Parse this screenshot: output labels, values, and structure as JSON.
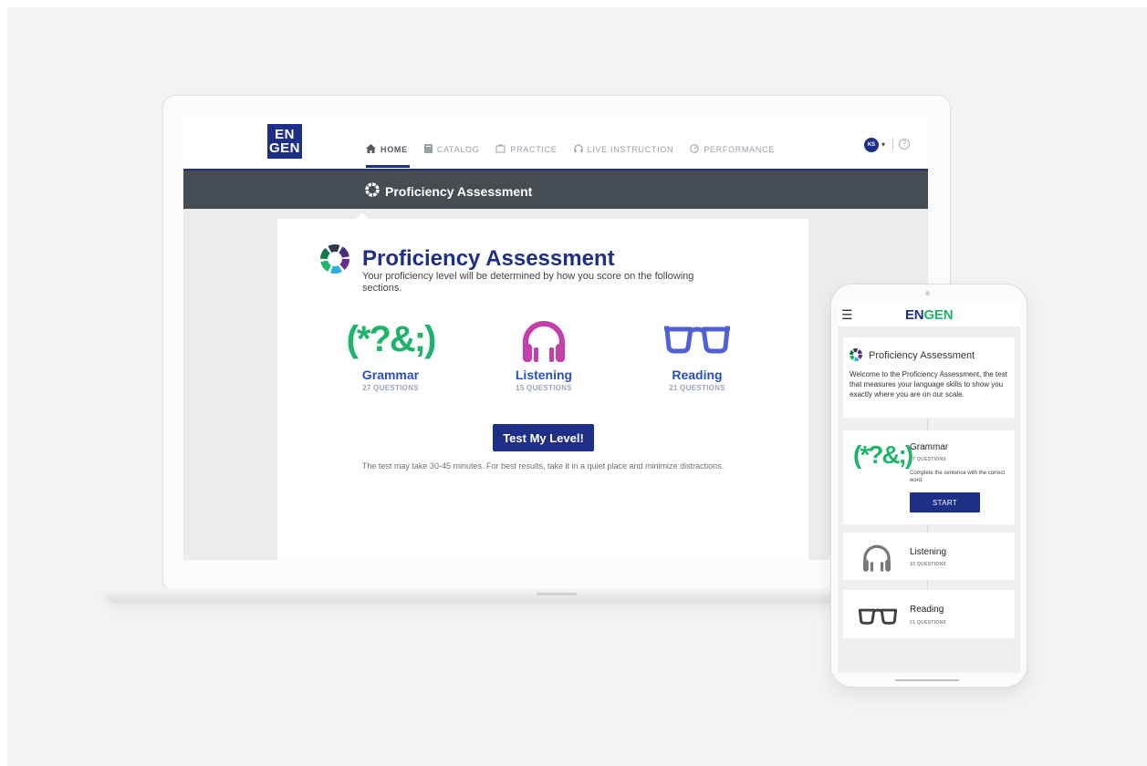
{
  "laptop": {
    "logo": {
      "line1": "EN",
      "line2": "GEN"
    },
    "nav": [
      {
        "label": "HOME",
        "icon": "home-icon",
        "active": true
      },
      {
        "label": "CATALOG",
        "icon": "book-icon",
        "active": false
      },
      {
        "label": "PRACTICE",
        "icon": "clipboard-icon",
        "active": false
      },
      {
        "label": "LIVE INSTRUCTION",
        "icon": "headset-icon",
        "active": false
      },
      {
        "label": "PERFORMANCE",
        "icon": "gauge-icon",
        "active": false
      }
    ],
    "user": {
      "initials": "KS",
      "help": "?"
    },
    "banner_title": "Proficiency Assessment",
    "card": {
      "title": "Proficiency Assessment",
      "subtitle": "Your proficiency level will be determined by how you score on the following sections.",
      "sections": [
        {
          "name": "Grammar",
          "count": "27 QUESTIONS",
          "glyph": "(*?&;)",
          "color": "#1fb46b"
        },
        {
          "name": "Listening",
          "count": "15 QUESTIONS",
          "color": "#c43fa9"
        },
        {
          "name": "Reading",
          "count": "21 QUESTIONS",
          "color": "#5160d6"
        }
      ],
      "button_label": "Test My Level!",
      "note": "The test may take 30-45 minutes. For best results, take it in a quiet place and minimize distractions."
    }
  },
  "phone": {
    "logo": {
      "part1": "EN",
      "part2": "GEN"
    },
    "intro": {
      "title": "Proficiency Assessment",
      "body": "Welcome to the Proficiency Assessment, the test that measures your language skills to show you exactly where you are on our scale."
    },
    "sections": [
      {
        "name": "Grammar",
        "count": "27 QUESTIONS",
        "description": "Complete the sentence with the correct word.",
        "button_label": "START"
      },
      {
        "name": "Listening",
        "count": "15 QUESTIONS"
      },
      {
        "name": "Reading",
        "count": "21 QUESTIONS"
      }
    ]
  },
  "colors": {
    "brand_navy": "#1d2f86",
    "grammar_green": "#1fb46b",
    "listening_magenta": "#c43fa9",
    "reading_blue": "#5160d6",
    "banner_gray": "#464d52"
  }
}
